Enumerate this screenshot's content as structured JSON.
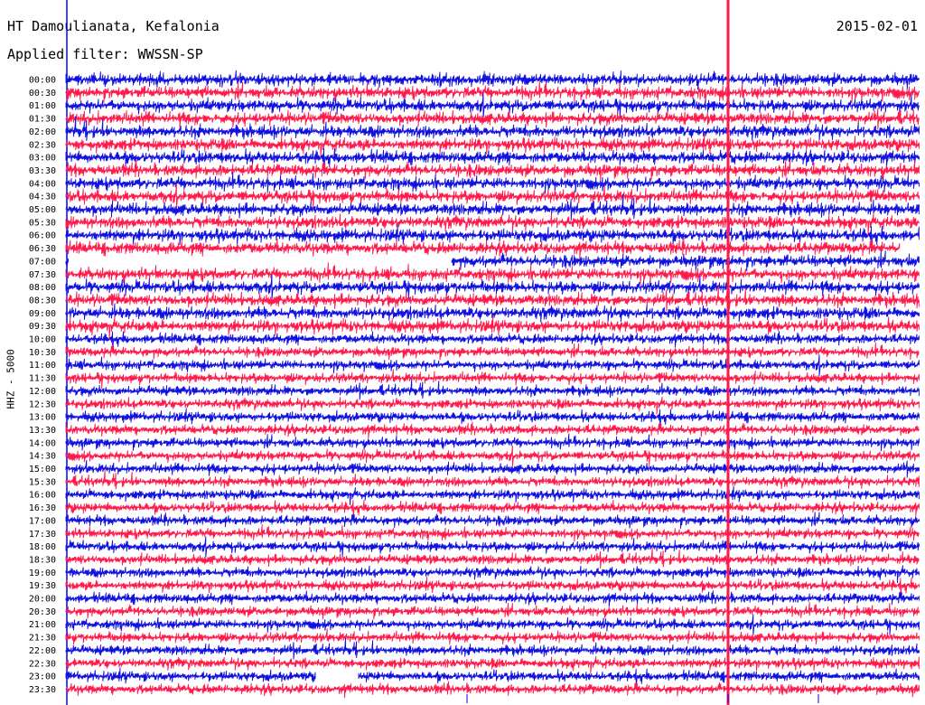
{
  "header": {
    "station": "HT Damoulianata, Kefalonia",
    "date": "2015-02-01",
    "filter": "Applied filter: WWSSN-SP"
  },
  "chart_data": {
    "type": "line",
    "title": "HT Damoulianata, Kefalonia",
    "ylabel": "HHZ - 5000",
    "row_labels": [
      "00:00",
      "00:30",
      "01:00",
      "01:30",
      "02:00",
      "02:30",
      "03:00",
      "03:30",
      "04:00",
      "04:30",
      "05:00",
      "05:30",
      "06:00",
      "06:30",
      "07:00",
      "07:30",
      "08:00",
      "08:30",
      "09:00",
      "09:30",
      "10:00",
      "10:30",
      "11:00",
      "11:30",
      "12:00",
      "12:30",
      "13:00",
      "13:30",
      "14:00",
      "14:30",
      "15:00",
      "15:30",
      "16:00",
      "16:30",
      "17:00",
      "17:30",
      "18:00",
      "18:30",
      "19:00",
      "19:30",
      "20:00",
      "20:30",
      "21:00",
      "21:30",
      "22:00",
      "22:30",
      "23:00",
      "23:30"
    ],
    "colors": {
      "even": "#1010e0",
      "odd": "#ff1a4b"
    },
    "marker_color": "#ff1a4b",
    "start_marker_color": "#0000ff",
    "grid": false
  }
}
